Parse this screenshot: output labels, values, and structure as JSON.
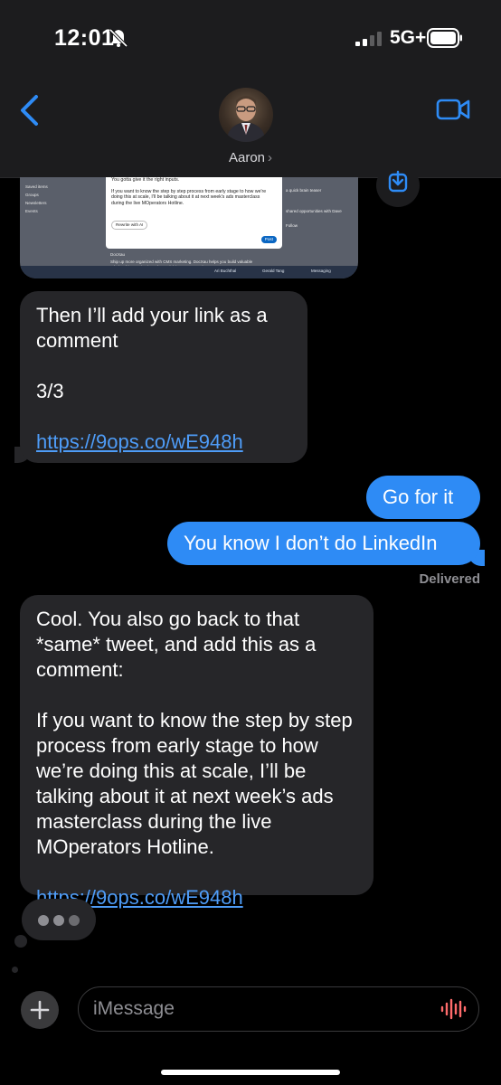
{
  "status_bar": {
    "time": "12:01",
    "network": "5G+"
  },
  "header": {
    "contact_name": "Aaron",
    "chevron": "›"
  },
  "attachment": {
    "dialog_line1": "You gotta give it the right inputs.",
    "dialog_line2": "If you want to know the step by step process from early stage to how we're doing this at scale, I'll be talking about it at next week's ads masterclass during the live MOperators Hotline.",
    "dialog_button": "Rewrite with AI",
    "dialog_post": "Post",
    "side_items": [
      "Saved items",
      "Groups",
      "Newsletters",
      "Events"
    ],
    "right_line1": "a quick brain teaser",
    "right_line2": "shared opportunities with Dave",
    "right_follow": "Follow",
    "bottom_name": "DocXau",
    "bottom_text": "Ship up more organized with CMS marketing. DocXau helps you build valuable relationships, maintain tasks, and drive repeat purchases.",
    "bar_items": [
      "Ari Buchthal",
      "Gerald Tang",
      "Messaging"
    ]
  },
  "messages": [
    {
      "direction": "in",
      "text": "Then I’ll add your link as a comment\n\n3/3",
      "link": "https://9ops.co/wE948h"
    },
    {
      "direction": "out",
      "text": "Go for it"
    },
    {
      "direction": "out",
      "text": "You know I don’t do LinkedIn"
    },
    {
      "direction": "in",
      "text": "Cool. You also go back to that *same* tweet, and add this as a comment:\n\nIf you want to know the step by step process from early stage to how we’re doing this at scale, I’ll be talking about it at next week’s ads masterclass during the live MOperators Hotline.",
      "link": "https://9ops.co/wE948h"
    }
  ],
  "delivered_label": "Delivered",
  "input": {
    "placeholder": "iMessage"
  },
  "icons": [
    "bell-slash-icon",
    "signal-icon",
    "battery-icon",
    "back-chevron-icon",
    "video-camera-icon",
    "save-download-icon",
    "plus-icon",
    "audio-waveform-icon",
    "typing-indicator"
  ],
  "colors": {
    "background": "#000000",
    "incoming_bubble": "#262629",
    "outgoing_bubble": "#2e8bf5",
    "link": "#4e9cf7",
    "accent": "#2e8bf5",
    "waveform": "#ff6b6b"
  }
}
